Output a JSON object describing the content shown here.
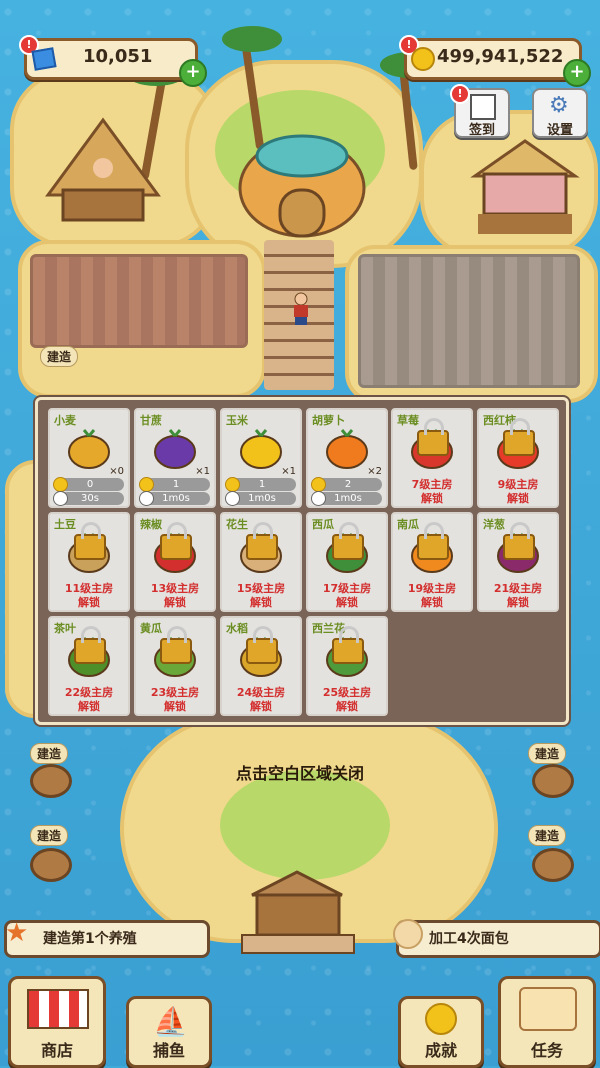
{
  "top_bar": {
    "gems": "10,051",
    "coins": "499,941,522"
  },
  "buttons": {
    "signin": "签到",
    "settings": "设置"
  },
  "build_label": "建造",
  "crops": [
    {
      "name": "小麦",
      "count": "×0",
      "coins": "0",
      "time": "30s",
      "color": "#e5a82a",
      "locked": false
    },
    {
      "name": "甘蔗",
      "count": "×1",
      "coins": "1",
      "time": "1m0s",
      "color": "#6a3aa8",
      "locked": false
    },
    {
      "name": "玉米",
      "count": "×1",
      "coins": "1",
      "time": "1m0s",
      "color": "#f2c21b",
      "locked": false
    },
    {
      "name": "胡萝卜",
      "count": "×2",
      "coins": "2",
      "time": "1m0s",
      "color": "#f07a1e",
      "locked": false
    },
    {
      "name": "草莓",
      "unlock_level": "7级主房",
      "unlock": "解锁",
      "color": "#d9362c",
      "locked": true
    },
    {
      "name": "西红柿",
      "unlock_level": "9级主房",
      "unlock": "解锁",
      "color": "#e53b28",
      "locked": true
    },
    {
      "name": "土豆",
      "unlock_level": "11级主房",
      "unlock": "解锁",
      "color": "#caa15a",
      "locked": true
    },
    {
      "name": "辣椒",
      "unlock_level": "13级主房",
      "unlock": "解锁",
      "color": "#d32f2f",
      "locked": true
    },
    {
      "name": "花生",
      "unlock_level": "15级主房",
      "unlock": "解锁",
      "color": "#d9b07a",
      "locked": true
    },
    {
      "name": "西瓜",
      "unlock_level": "17级主房",
      "unlock": "解锁",
      "color": "#3f8f3a",
      "locked": true
    },
    {
      "name": "南瓜",
      "unlock_level": "19级主房",
      "unlock": "解锁",
      "color": "#f08a1e",
      "locked": true
    },
    {
      "name": "洋葱",
      "unlock_level": "21级主房",
      "unlock": "解锁",
      "color": "#8a2a6a",
      "locked": true
    },
    {
      "name": "茶叶",
      "unlock_level": "22级主房",
      "unlock": "解锁",
      "color": "#4f8f2a",
      "locked": true
    },
    {
      "name": "黄瓜",
      "unlock_level": "23级主房",
      "unlock": "解锁",
      "color": "#6aa83a",
      "locked": true
    },
    {
      "name": "水稻",
      "unlock_level": "24级主房",
      "unlock": "解锁",
      "color": "#d9a62a",
      "locked": true
    },
    {
      "name": "西兰花",
      "unlock_level": "25级主房",
      "unlock": "解锁",
      "color": "#4f9a3a",
      "locked": true
    }
  ],
  "close_hint": "点击空白区域关闭",
  "quests": {
    "left": "建造第1个养殖",
    "right": "加工4次面包"
  },
  "bottom_nav": {
    "shop": "商店",
    "fishing": "捕鱼",
    "achievements": "成就",
    "tasks": "任务"
  }
}
